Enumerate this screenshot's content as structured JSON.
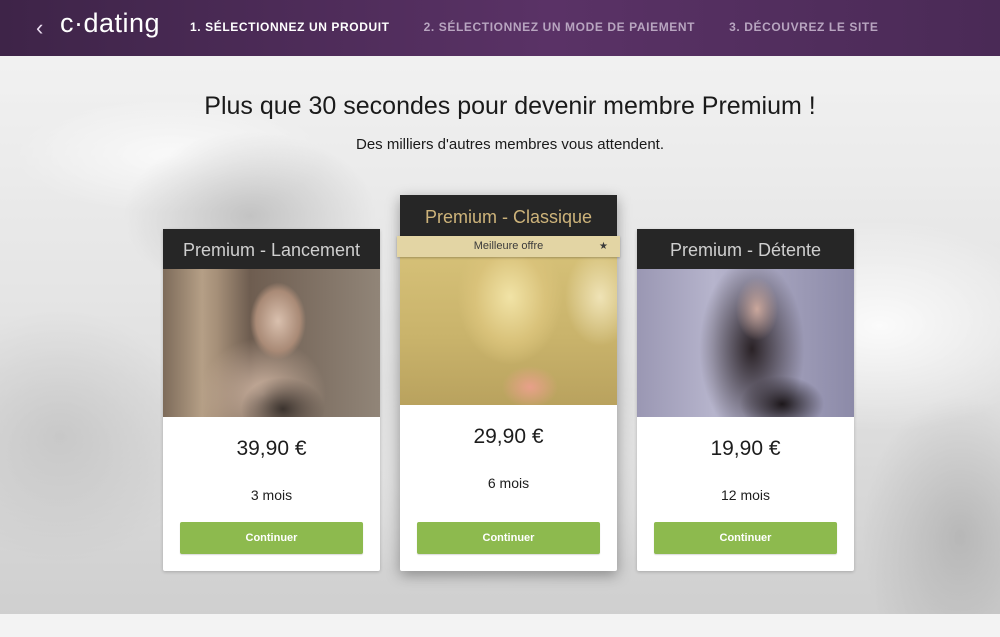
{
  "header": {
    "logo": "c·dating",
    "back_icon": "chevron-left-icon",
    "steps": [
      {
        "label": "1. SÉLECTIONNEZ UN PRODUIT",
        "active": true
      },
      {
        "label": "2. SÉLECTIONNEZ UN MODE DE PAIEMENT",
        "active": false
      },
      {
        "label": "3. DÉCOUVREZ LE SITE",
        "active": false
      }
    ]
  },
  "main": {
    "title": "Plus que 30 secondes pour devenir membre Premium !",
    "subtitle": "Des milliers d'autres membres vous attendent."
  },
  "plans": [
    {
      "name": "Premium - Lancement",
      "price": "39,90 €",
      "duration": "3 mois",
      "button": "Continuer"
    },
    {
      "name": "Premium - Classique",
      "price": "29,90 €",
      "duration": "6 mois",
      "button": "Continuer",
      "badge": "Meilleure offre",
      "badge_icon": "star-icon"
    },
    {
      "name": "Premium - Détente",
      "price": "19,90 €",
      "duration": "12 mois",
      "button": "Continuer"
    }
  ],
  "colors": {
    "header_bg": "#4a2a56",
    "button_green": "#8dba4e",
    "badge_bg": "#e3d5a4",
    "featured_title": "#cdb37a"
  }
}
